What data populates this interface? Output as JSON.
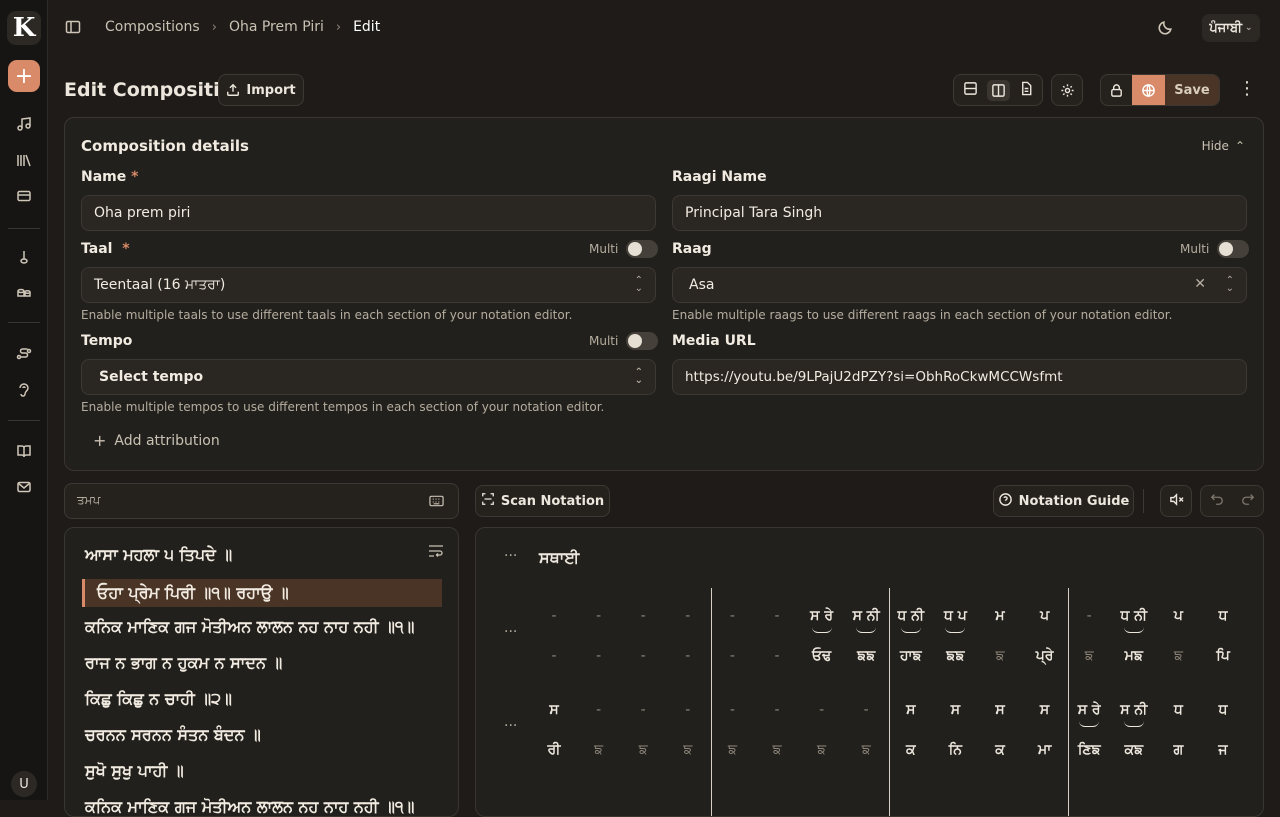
{
  "app": {
    "logo": "K",
    "user_initial": "U"
  },
  "breadcrumb": {
    "items": [
      "Compositions",
      "Oha Prem Piri"
    ],
    "current": "Edit"
  },
  "topbar": {
    "language": "ਪੰਜਾਬੀ"
  },
  "header": {
    "title": "Edit Composition",
    "import_label": "Import",
    "save_label": "Save"
  },
  "details": {
    "title": "Composition details",
    "hide_label": "Hide",
    "name": {
      "label": "Name",
      "value": "Oha prem piri"
    },
    "raagi": {
      "label": "Raagi Name",
      "value": "Principal Tara Singh"
    },
    "taal": {
      "label": "Taal",
      "multi": "Multi",
      "value": "Teentaal (16 ਮਾਤਰਾ)",
      "help": "Enable multiple taals to use different taals in each section of your notation editor."
    },
    "raag": {
      "label": "Raag",
      "multi": "Multi",
      "value": "Asa",
      "help": "Enable multiple raags to use different raags in each section of your notation editor."
    },
    "tempo": {
      "label": "Tempo",
      "multi": "Multi",
      "value": "Select tempo",
      "help": "Enable multiple tempos to use different tempos in each section of your notation editor."
    },
    "media": {
      "label": "Media URL",
      "value": "https://youtu.be/9LPajU2dPZY?si=ObhRoCkwMCCWsfmt"
    },
    "attribution_label": "Add attribution"
  },
  "editor": {
    "search_value": "ਤਮਪ",
    "scan_label": "Scan Notation",
    "guide_label": "Notation Guide",
    "lines": [
      "ਆਸਾ ਮਹਲਾ ੫ ਤਿਪਦੇ ॥",
      "ਓਹਾ ਪ੍ਰੇਮ ਪਿਰੀ ॥੧॥ ਰਹਾਉ ॥",
      "ਕਨਿਕ ਮਾਣਿਕ ਗਜ ਮੋਤੀਅਨ ਲਾਲਨ ਨਹ ਨਾਹ ਨਹੀ ॥੧॥",
      "ਰਾਜ ਨ ਭਾਗ ਨ ਹੁਕਮ ਨ ਸਾਦਨ ॥",
      "ਕਿਛੁ ਕਿਛੁ ਨ ਚਾਹੀ ॥੨॥",
      "ਚਰਨਨ ਸਰਨਨ ਸੰਤਨ ਬੰਦਨ ॥",
      "ਸੁਖੋ ਸੁਖੁ ਪਾਹੀ ॥"
    ]
  },
  "notation": {
    "section_title": "ਸਥਾਈ",
    "more": "···",
    "row1_top": [
      "-",
      "-",
      "-",
      "-",
      "-",
      "-",
      "ਸ ਰੇ",
      "ਸ ਨੀ",
      "ਧ ਨੀ",
      "ਧ ਪ",
      "ਮ",
      "ਪ",
      "-",
      "ਧ ਨੀ",
      "ਪ",
      "ਧ"
    ],
    "row1_bot": [
      "-",
      "-",
      "-",
      "-",
      "-",
      "-",
      "ਓਢ",
      "ਙਙ",
      "ਹਾਙ",
      "ਙਙ",
      "ਙ",
      "ਪ੍ਰੇ",
      "ਙ",
      "ਮਙ",
      "ਙ",
      "ਪਿ"
    ],
    "row2_top": [
      "ਸ",
      "-",
      "-",
      "-",
      "-",
      "-",
      "-",
      "-",
      "ਸ",
      "ਸ",
      "ਸ",
      "ਸ",
      "ਸ ਰੇ",
      "ਸ ਨੀ",
      "ਧ",
      "ਧ"
    ],
    "row2_bot": [
      "ਰੀ",
      "ਙ",
      "ਙ",
      "ਙ",
      "ਙ",
      "ਙ",
      "ਙ",
      "ਙ",
      "ਕ",
      "ਨਿ",
      "ਕ",
      "ਮਾ",
      "ਣਿਙ",
      "ਕਙ",
      "ਗ",
      "ਜ"
    ]
  }
}
